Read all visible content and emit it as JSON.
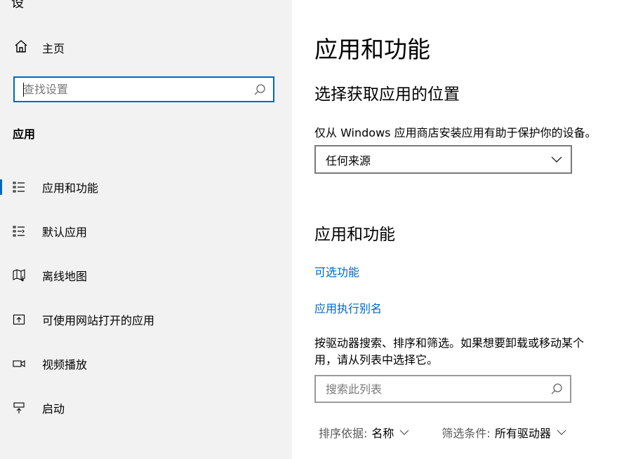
{
  "sidebar": {
    "title_fragment": "设",
    "home_label": "主页",
    "search_placeholder": "查找设置",
    "section_label": "应用",
    "items": [
      {
        "label": "应用和功能",
        "icon": "apps-features-icon",
        "active": true
      },
      {
        "label": "默认应用",
        "icon": "default-apps-icon",
        "active": false
      },
      {
        "label": "离线地图",
        "icon": "offline-maps-icon",
        "active": false
      },
      {
        "label": "可使用网站打开的应用",
        "icon": "apps-for-websites-icon",
        "active": false
      },
      {
        "label": "视频播放",
        "icon": "video-playback-icon",
        "active": false
      },
      {
        "label": "启动",
        "icon": "startup-icon",
        "active": false
      }
    ]
  },
  "main": {
    "title": "应用和功能",
    "install_section": {
      "heading": "选择获取应用的位置",
      "description": "仅从 Windows 应用商店安装应用有助于保护你的设备。",
      "dropdown_value": "任何来源"
    },
    "apps_section": {
      "heading": "应用和功能",
      "link_optional": "可选功能",
      "link_alias": "应用执行别名",
      "para_line1": "按驱动器搜索、排序和筛选。如果想要卸载或移动某个",
      "para_line2": "用，请从列表中选择它。",
      "list_search_placeholder": "搜索此列表",
      "sort_key": "排序依据:",
      "sort_value": "名称",
      "filter_key": "筛选条件:",
      "filter_value": "所有驱动器"
    }
  },
  "colors": {
    "accent": "#0067c0",
    "sidebar_bg": "#f2f2f2",
    "content_bg": "#ffffff"
  }
}
